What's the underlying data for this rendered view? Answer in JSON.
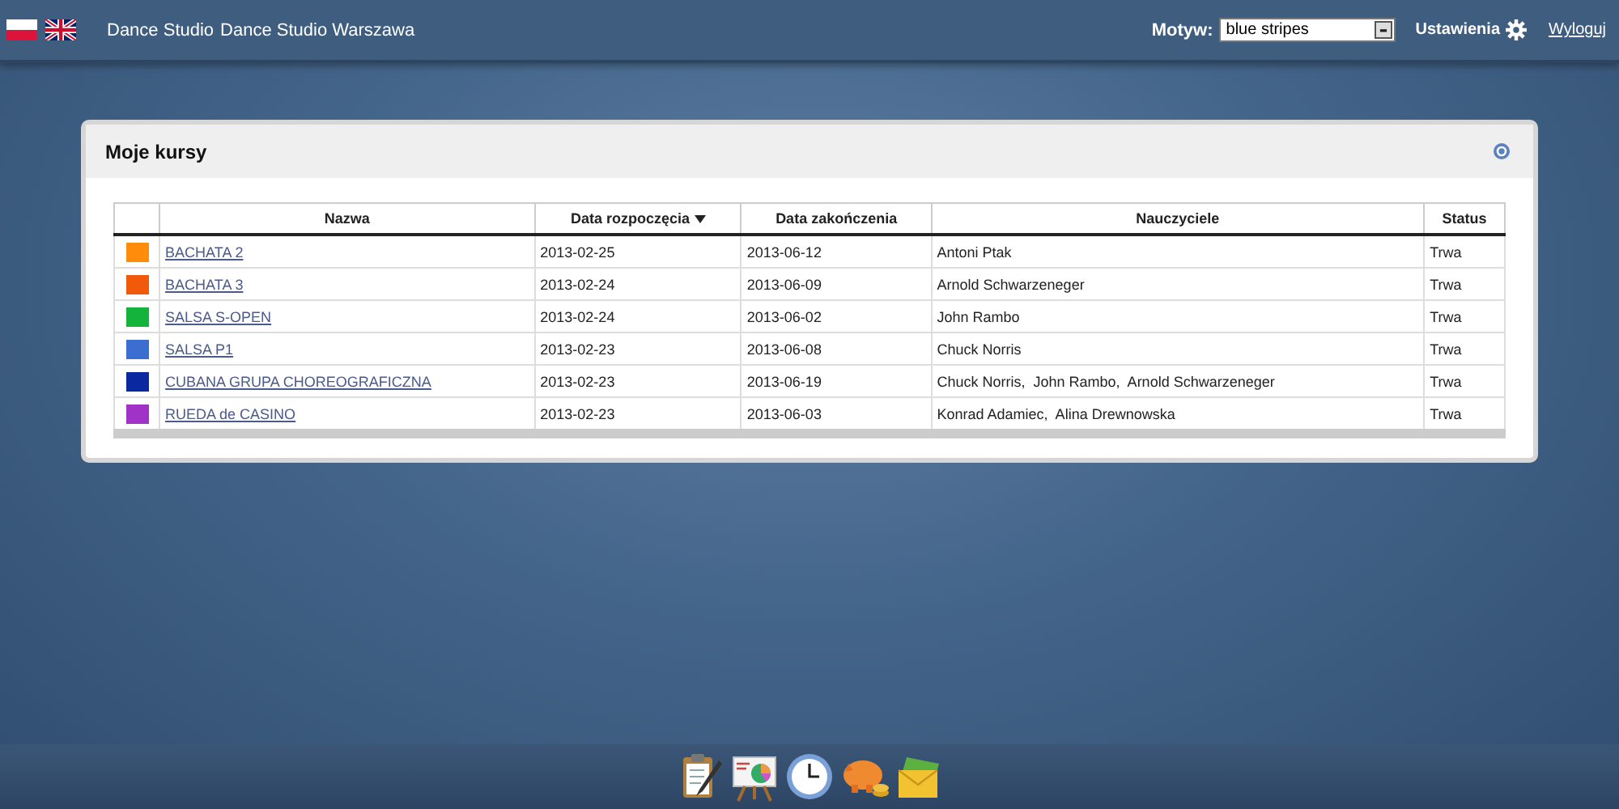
{
  "header": {
    "languages": [
      {
        "kind": "pl"
      },
      {
        "kind": "en"
      }
    ],
    "title": "Dance Studio",
    "subtitle": "Dance Studio Warszawa",
    "theme_label": "Motyw:",
    "theme_value": "blue stripes",
    "settings": "Ustawienia",
    "logout": "Wyloguj"
  },
  "panel": {
    "title": "Moje kursy",
    "table": {
      "columns": [
        {
          "label": "Nazwa",
          "sorted": false
        },
        {
          "label": "Data rozpoczęcia",
          "sorted": true
        },
        {
          "label": "Data zakończenia",
          "sorted": false
        },
        {
          "label": "Nauczyciele",
          "sorted": false
        },
        {
          "label": "Status",
          "sorted": false
        }
      ],
      "rows": [
        {
          "color": "#ff8c0a",
          "name": "BACHATA 2",
          "start": "2013-02-25",
          "end": "2013-06-12",
          "teachers": "Antoni Ptak",
          "status": "Trwa"
        },
        {
          "color": "#f05a0a",
          "name": "BACHATA 3",
          "start": "2013-02-24",
          "end": "2013-06-09",
          "teachers": "Arnold Schwarzeneger",
          "status": "Trwa"
        },
        {
          "color": "#14b43c",
          "name": "SALSA S-OPEN",
          "start": "2013-02-24",
          "end": "2013-06-02",
          "teachers": "John Rambo",
          "status": "Trwa"
        },
        {
          "color": "#3c6ed2",
          "name": "SALSA P1",
          "start": "2013-02-23",
          "end": "2013-06-08",
          "teachers": "Chuck Norris",
          "status": "Trwa"
        },
        {
          "color": "#0a28a0",
          "name": "CUBANA GRUPA CHOREOGRAFICZNA",
          "start": "2013-02-23",
          "end": "2013-06-19",
          "teachers": "Chuck Norris,  John Rambo,  Arnold Schwarzeneger",
          "status": "Trwa"
        },
        {
          "color": "#a032c8",
          "name": "RUEDA de CASINO",
          "start": "2013-02-23",
          "end": "2013-06-03",
          "teachers": "Konrad Adamiec,  Alina Drewnowska",
          "status": "Trwa"
        }
      ]
    }
  },
  "dock": [
    {
      "kind": "clipboard"
    },
    {
      "kind": "presentation"
    },
    {
      "kind": "clock"
    },
    {
      "kind": "piggy"
    },
    {
      "kind": "mail"
    }
  ]
}
